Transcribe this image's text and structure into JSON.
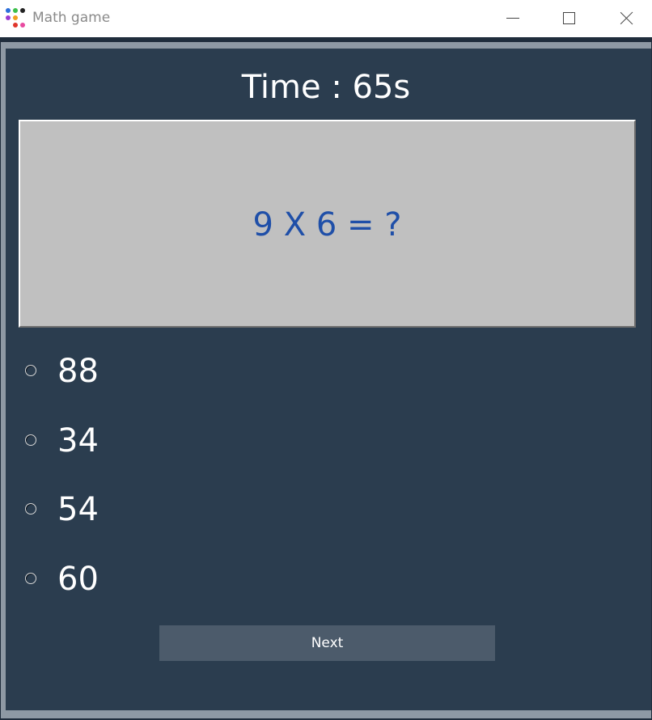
{
  "window": {
    "title": "Math game",
    "icon": "app-dots-icon"
  },
  "titlebar_buttons": [
    "minimize-icon",
    "maximize-icon",
    "close-icon"
  ],
  "timer": {
    "text": "Time : 65s"
  },
  "question": {
    "text": "9 X 6 = ?"
  },
  "options": [
    {
      "label": "88"
    },
    {
      "label": "34"
    },
    {
      "label": "54"
    },
    {
      "label": "60"
    }
  ],
  "next_button": {
    "label": "Next"
  },
  "colors": {
    "background": "#2b3d4f",
    "question_box": "#c0c0c0",
    "question_text": "#1f4fa8",
    "button": "#4c5b6b",
    "text": "#ffffff"
  }
}
